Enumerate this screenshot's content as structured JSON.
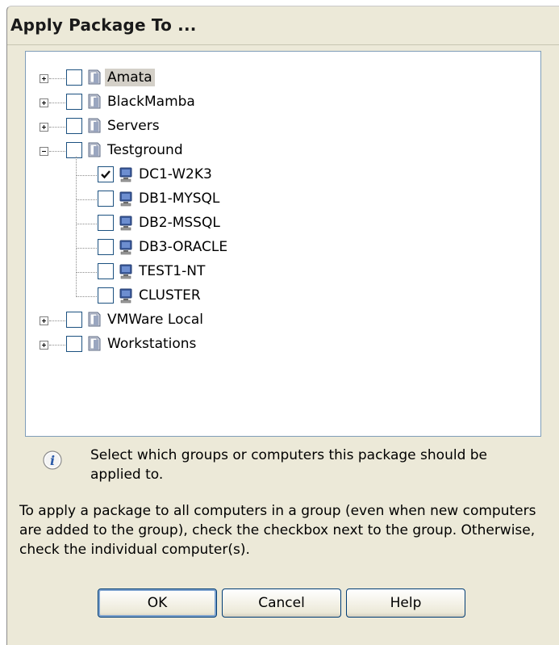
{
  "dialog": {
    "title": "Apply Package To ..."
  },
  "tree": {
    "groups": [
      {
        "label": "Amata",
        "expanded": false,
        "checked": false,
        "selected": true
      },
      {
        "label": "BlackMamba",
        "expanded": false,
        "checked": false
      },
      {
        "label": "Servers",
        "expanded": false,
        "checked": false
      },
      {
        "label": "Testground",
        "expanded": true,
        "checked": false,
        "children": [
          {
            "label": "DC1-W2K3",
            "checked": true
          },
          {
            "label": "DB1-MYSQL",
            "checked": false
          },
          {
            "label": "DB2-MSSQL",
            "checked": false
          },
          {
            "label": "DB3-ORACLE",
            "checked": false
          },
          {
            "label": "TEST1-NT",
            "checked": false
          },
          {
            "label": "CLUSTER",
            "checked": false
          }
        ]
      },
      {
        "label": "VMWare Local",
        "expanded": false,
        "checked": false
      },
      {
        "label": "Workstations",
        "expanded": false,
        "checked": false
      }
    ]
  },
  "info": {
    "icon": "info-icon",
    "text": "Select which groups or computers this package should be applied to."
  },
  "help_text": "To apply a package to all computers in a group (even when new computers are added to the group), check the checkbox next to the group. Otherwise, check the individual computer(s).",
  "buttons": {
    "ok": "OK",
    "cancel": "Cancel",
    "help": "Help"
  },
  "colors": {
    "dialog_bg": "#ece9d8",
    "tree_border": "#7f9db9",
    "check": "#21a121"
  }
}
